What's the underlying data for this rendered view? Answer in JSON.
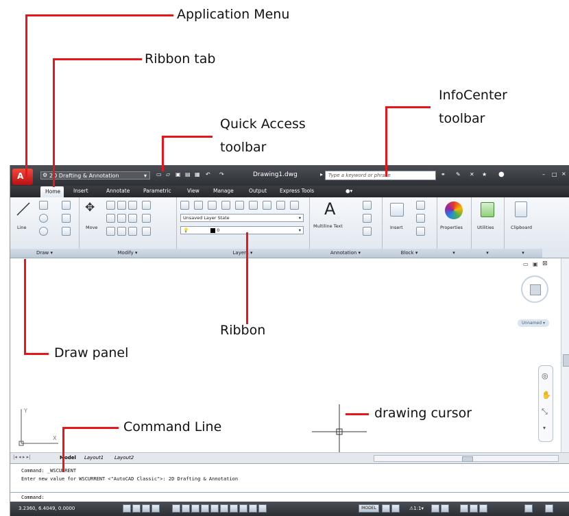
{
  "annotations": {
    "application_menu": "Application Menu",
    "ribbon_tab": "Ribbon tab",
    "quick_access_line1": "Quick Access",
    "quick_access_line2": "toolbar",
    "infocenter_line1": "InfoCenter",
    "infocenter_line2": "toolbar",
    "ribbon": "Ribbon",
    "draw_panel": "Draw panel",
    "drawing_cursor": "drawing cursor",
    "command_line": "Command Line"
  },
  "window": {
    "workspace": "2D Drafting & Annotation",
    "title": "Drawing1.dwg",
    "search_placeholder": "Type a keyword or phrase"
  },
  "tabs": [
    "Home",
    "Insert",
    "Annotate",
    "Parametric",
    "View",
    "Manage",
    "Output",
    "Express Tools"
  ],
  "ribbon": {
    "draw": {
      "title": "Draw",
      "line": "Line"
    },
    "modify": {
      "title": "Modify",
      "move": "Move"
    },
    "layers": {
      "title": "Layers",
      "layer_state": "Unsaved Layer State",
      "current_layer": "0"
    },
    "annotation": {
      "title": "Annotation",
      "mtext": "Multiline Text"
    },
    "block": {
      "title": "Block",
      "insert": "Insert"
    },
    "properties": "Properties",
    "utilities": "Utilities",
    "clipboard": "Clipboard"
  },
  "viewcube": {
    "label": "Unnamed"
  },
  "layout_tabs": [
    "Model",
    "Layout1",
    "Layout2"
  ],
  "command": {
    "history1": "Command: _WSCURRENT",
    "history2": "Enter new value for WSCURRENT <\"AutoCAD Classic\">: 2D Drafting & Annotation",
    "prompt": "Command:"
  },
  "status": {
    "coords": "3.2360, 6.4049, 0.0000",
    "model": "MODEL",
    "scale": "1:1"
  },
  "colors": {
    "accent": "#e8151b",
    "titlebar": "#3a3d42",
    "ribbon": "#e6ecf2"
  }
}
